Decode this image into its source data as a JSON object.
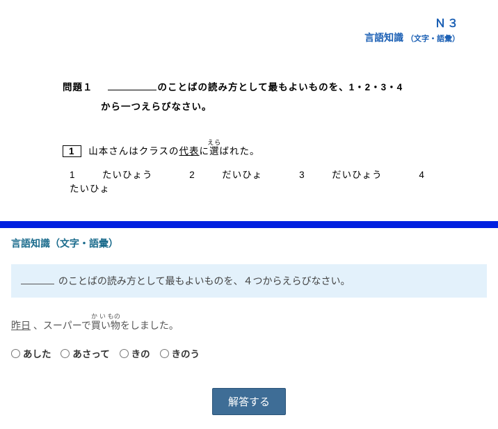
{
  "header": {
    "level": "Ｎ３",
    "category_main": "言語知識",
    "category_sub": "（文字・語彙）"
  },
  "section1": {
    "mondai_label": "問題１",
    "instruction_part1": "のことばの読み方として最もよいものを、1・2・3・4",
    "instruction_part2": "から一つえらびなさい。",
    "question_number": "1",
    "sentence_pre": "山本さんはクラスの",
    "sentence_underlined": "代表",
    "sentence_post1": "に",
    "ruby_base": "選",
    "ruby_text": "えら",
    "sentence_post2": "ばれた。",
    "options": [
      {
        "num": "1",
        "text": "たいひょう"
      },
      {
        "num": "2",
        "text": "だいひょ"
      },
      {
        "num": "3",
        "text": "だいひょう"
      },
      {
        "num": "4",
        "text": "たいひょ"
      }
    ]
  },
  "section2": {
    "title": "言語知識（文字・語彙）",
    "instruction": "のことばの読み方として最もよいものを、４つからえらびなさい。",
    "q_ruby_base": "昨日",
    "sentence_mid1": " 、スーパーで",
    "ruby2_base": "買い物",
    "ruby2_text": "か い もの",
    "sentence_mid2": "をしました。",
    "options": [
      "あした",
      "あさって",
      "きの",
      "きのう"
    ],
    "submit_label": "解答する"
  }
}
